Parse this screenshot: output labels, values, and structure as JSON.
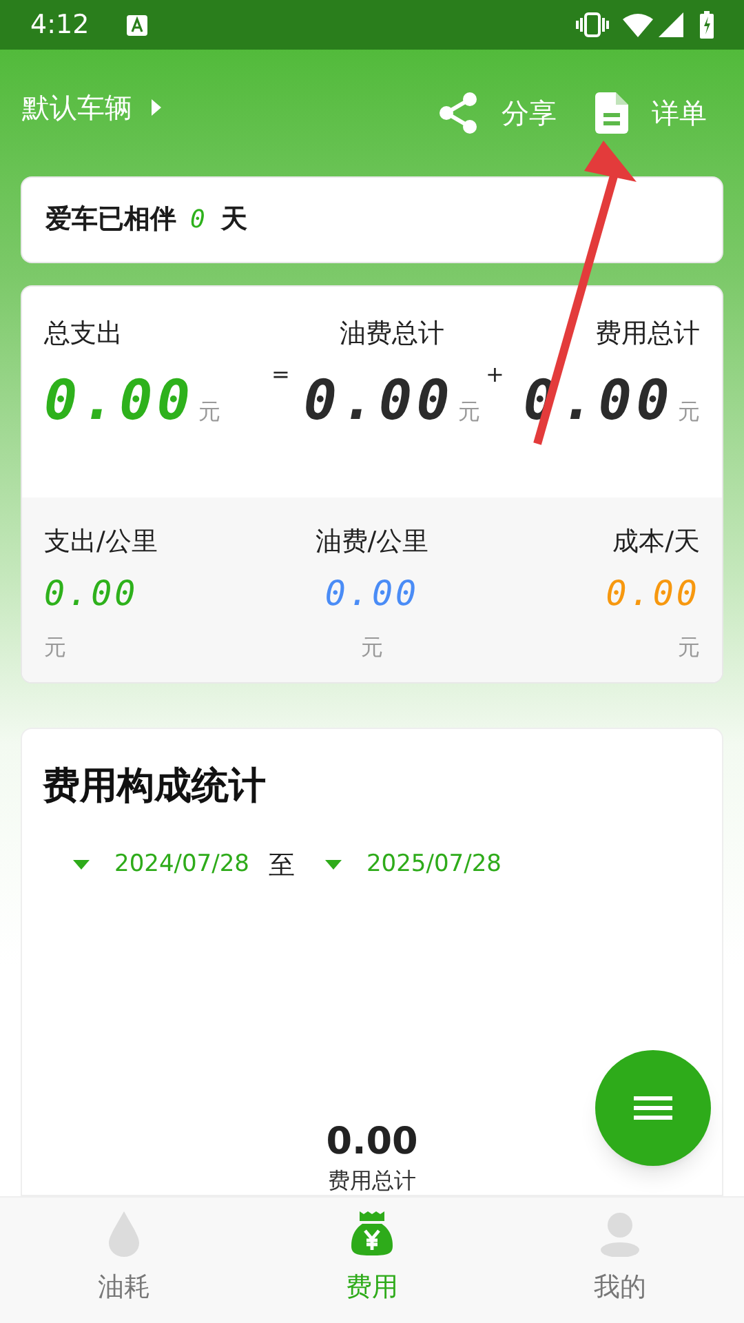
{
  "status_bar": {
    "time": "4:12"
  },
  "header": {
    "vehicle": "默认车辆",
    "actions": [
      {
        "kind": "share",
        "label": "分享"
      },
      {
        "kind": "detail",
        "label": "详单"
      }
    ]
  },
  "companion": {
    "prefix": "爱车已相伴",
    "days": "0",
    "suffix": "天"
  },
  "totals": [
    {
      "label": "总支出",
      "value": "0.00",
      "unit": "元",
      "color": "#2eb11c"
    },
    {
      "operator": "=",
      "label": "油费总计",
      "value": "0.00",
      "unit": "元",
      "color": "#2b2b2b"
    },
    {
      "operator": "+",
      "label": "费用总计",
      "value": "0.00",
      "unit": "元",
      "color": "#2b2b2b"
    }
  ],
  "rates": [
    {
      "label": "支出/公里",
      "value": "0.00",
      "unit": "元",
      "color": "#2eb11c"
    },
    {
      "label": "油费/公里",
      "value": "0.00",
      "unit": "元",
      "color": "#4a8cf6"
    },
    {
      "label": "成本/天",
      "value": "0.00",
      "unit": "元",
      "color": "#f7980f"
    }
  ],
  "stats": {
    "title": "费用构成统计",
    "start_date": "2024/07/28",
    "separator": "至",
    "end_date": "2025/07/28",
    "total": "0.00",
    "total_label": "费用总计"
  },
  "nav": [
    {
      "kind": "drop",
      "label": "油耗",
      "selected": false
    },
    {
      "kind": "money",
      "label": "费用",
      "selected": true
    },
    {
      "kind": "person",
      "label": "我的",
      "selected": false
    }
  ]
}
